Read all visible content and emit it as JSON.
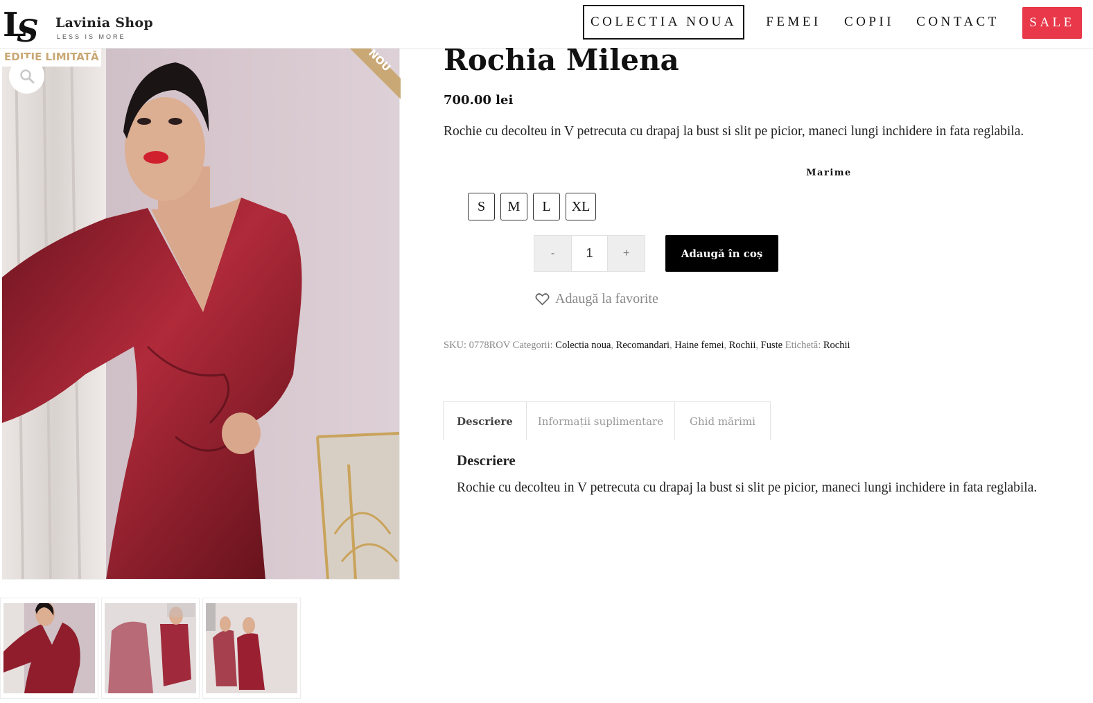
{
  "header": {
    "logo_name": "Lavinia Shop",
    "logo_monogram": "LS",
    "logo_tagline": "LESS IS MORE",
    "nav": [
      {
        "label": "COLECTIA NOUA"
      },
      {
        "label": "FEMEI"
      },
      {
        "label": "COPII"
      },
      {
        "label": "CONTACT"
      },
      {
        "label": "SALE"
      }
    ],
    "sale_color": "#e8384a"
  },
  "gallery": {
    "badge_limited": "EDIȚIE LIMITATĂ",
    "corner_badge": "NOU",
    "badge_color": "#c9a875",
    "dress_color": "#8f1d2b"
  },
  "product": {
    "title": "Rochia Milena",
    "price": "700.00 lei",
    "short_description": "Rochie cu decolteu in V petrecuta cu drapaj la bust si slit pe picior, maneci lungi inchidere in fata reglabila.",
    "size_label": "Marime",
    "sizes": [
      "S",
      "M",
      "L",
      "XL"
    ],
    "qty_minus": "-",
    "qty_value": "1",
    "qty_plus": "+",
    "add_to_cart": "Adaugă în coș",
    "wishlist": "Adaugă la favorite",
    "meta": {
      "sku_label": "SKU:",
      "sku": "0778ROV",
      "categories_label": "Categorii:",
      "categories": [
        "Colectia noua",
        "Recomandari",
        "Haine femei",
        "Rochii",
        "Fuste"
      ],
      "tag_label": "Etichetă:",
      "tag": "Rochii"
    }
  },
  "tabs": [
    {
      "label": "Descriere"
    },
    {
      "label": "Informații suplimentare"
    },
    {
      "label": "Ghid mărimi"
    }
  ],
  "panel": {
    "title": "Descriere",
    "text": "Rochie cu decolteu in V petrecuta cu drapaj la bust si slit pe picior, maneci lungi inchidere in fata reglabila."
  }
}
